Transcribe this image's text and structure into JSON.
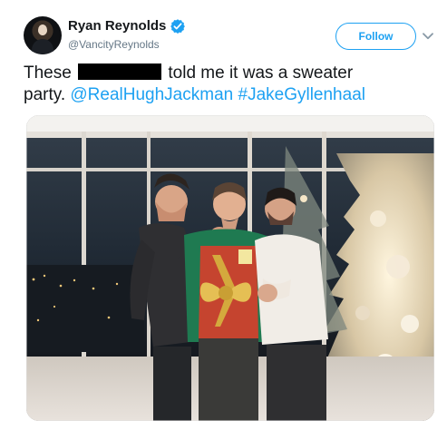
{
  "user": {
    "display_name": "Ryan Reynolds",
    "handle": "@VancityReynolds"
  },
  "actions": {
    "follow_label": "Follow",
    "more_icon": "chevron-down-icon"
  },
  "tweet": {
    "parts": {
      "start": "These ",
      "middle": " told me it was a sweater",
      "line2_start": "party. ",
      "mention": "@RealHughJackman",
      "space": " ",
      "hashtag": "#JakeGyllenhaal"
    }
  },
  "media": {
    "type": "photo"
  },
  "colors": {
    "twitter_blue": "#1da1f2",
    "text_primary": "#14171a",
    "text_secondary": "#657786"
  }
}
